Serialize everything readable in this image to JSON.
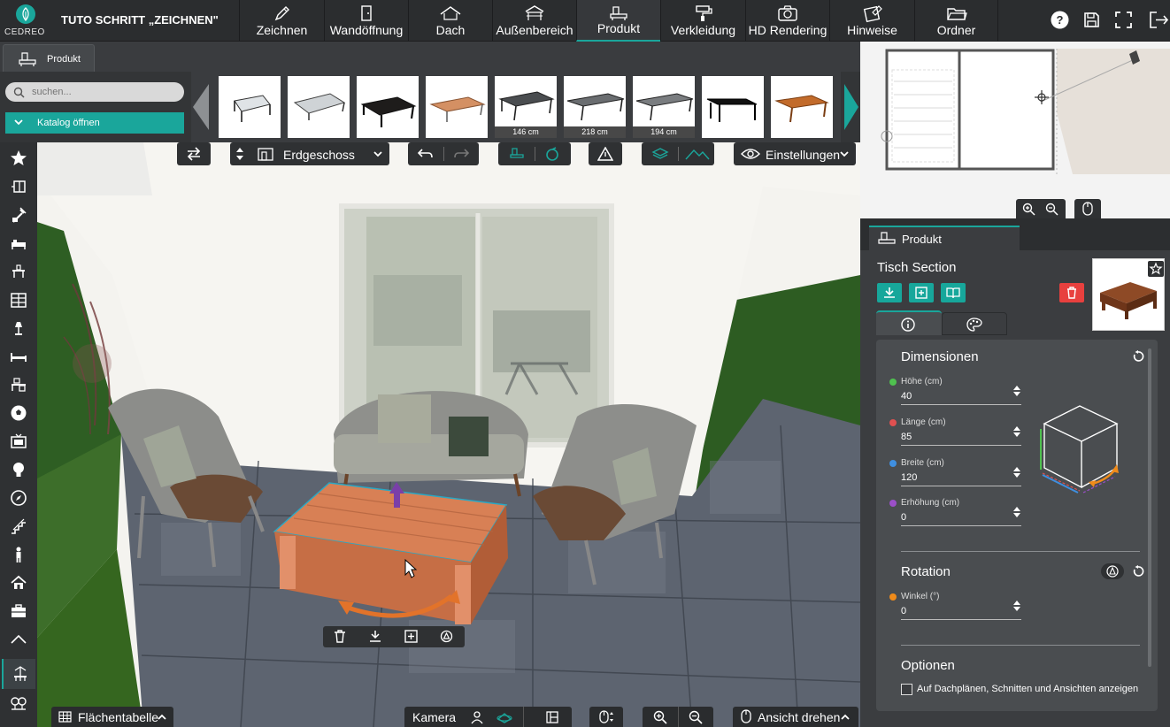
{
  "app": {
    "logo_text": "CEDREO",
    "project_title": "TUTO SCHRITT „ZEICHNEN\""
  },
  "main_tabs": [
    {
      "label": "Zeichnen",
      "icon": "pencil-icon"
    },
    {
      "label": "Wandöffnung",
      "icon": "door-icon"
    },
    {
      "label": "Dach",
      "icon": "roof-icon"
    },
    {
      "label": "Außenbereich",
      "icon": "pergola-icon"
    },
    {
      "label": "Produkt",
      "icon": "furniture-icon",
      "active": true
    },
    {
      "label": "Verkleidung",
      "icon": "paint-roller-icon"
    },
    {
      "label": "HD Rendering",
      "icon": "camera-icon"
    },
    {
      "label": "Hinweise",
      "icon": "notes-icon"
    },
    {
      "label": "Ordner",
      "icon": "folder-icon"
    }
  ],
  "sub_tab": {
    "label": "Produkt"
  },
  "search": {
    "placeholder": "suchen..."
  },
  "catalog_button": {
    "label": "Katalog öffnen"
  },
  "catalog_thumbs": [
    {
      "caption": ""
    },
    {
      "caption": ""
    },
    {
      "caption": ""
    },
    {
      "caption": ""
    },
    {
      "caption": "146 cm"
    },
    {
      "caption": "218 cm"
    },
    {
      "caption": "194 cm"
    },
    {
      "caption": ""
    },
    {
      "caption": ""
    }
  ],
  "view_toolbar": {
    "floor_select": "Erdgeschoss",
    "settings_label": "Einstellungen"
  },
  "right_panel": {
    "tab_label": "Produkt",
    "product_name": "Tisch Section",
    "dimensions_title": "Dimensionen",
    "fields": [
      {
        "label": "Höhe (cm)",
        "value": "40",
        "color": "#4fc14f"
      },
      {
        "label": "Länge (cm)",
        "value": "85",
        "color": "#e05050"
      },
      {
        "label": "Breite (cm)",
        "value": "120",
        "color": "#3f8fe0"
      },
      {
        "label": "Erhöhung (cm)",
        "value": "0",
        "color": "#9b4fc8"
      }
    ],
    "rotation_title": "Rotation",
    "rotation_field": {
      "label": "Winkel (°)",
      "value": "0",
      "color": "#f08b1a"
    },
    "options_title": "Optionen",
    "option_checkbox": "Auf Dachplänen, Schnitten und Ansichten anzeigen"
  },
  "bottom_bar": {
    "area_table": "Flächentabelle",
    "camera": "Kamera",
    "rotate_view": "Ansicht drehen"
  },
  "colors": {
    "accent": "#1aa69b",
    "delete": "#e8403e",
    "bg_dark": "#2b2d2f"
  }
}
